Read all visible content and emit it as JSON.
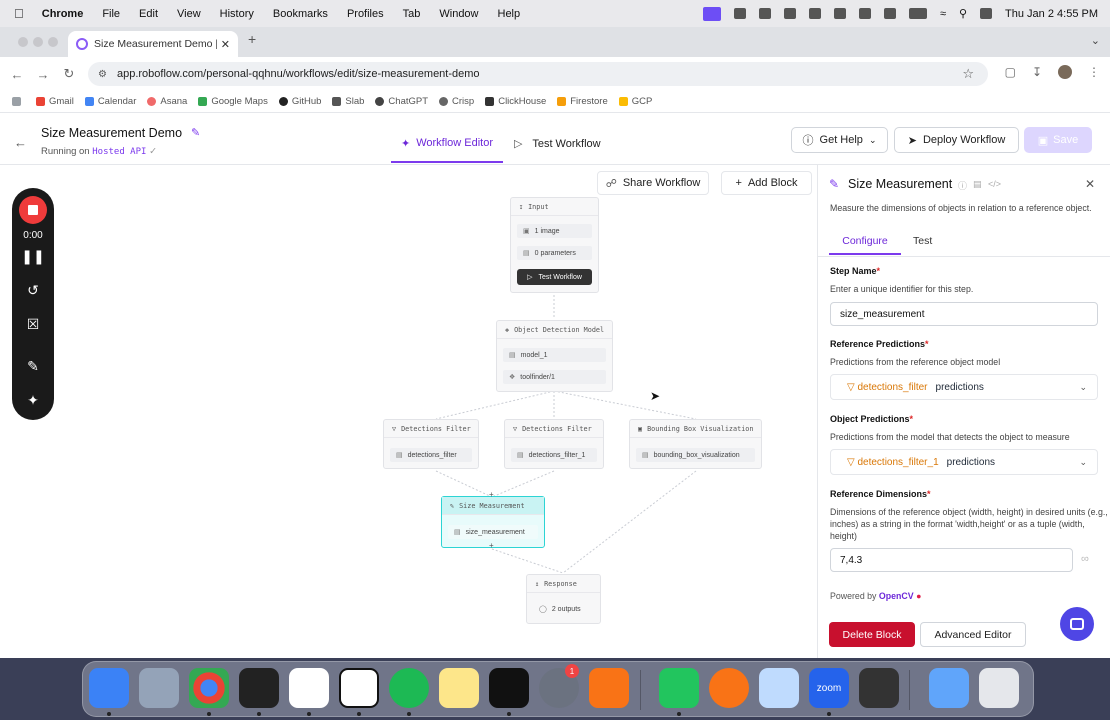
{
  "menubar": {
    "app": "Chrome",
    "items": [
      "File",
      "Edit",
      "View",
      "History",
      "Bookmarks",
      "Profiles",
      "Tab",
      "Window",
      "Help"
    ],
    "datetime": "Thu Jan 2  4:55 PM"
  },
  "browser": {
    "tab_title": "Size Measurement Demo | W",
    "url": "app.roboflow.com/personal-qqhnu/workflows/edit/size-measurement-demo",
    "bookmarks": [
      "Gmail",
      "Calendar",
      "Asana",
      "Google Maps",
      "GitHub",
      "Slab",
      "ChatGPT",
      "Crisp",
      "ClickHouse",
      "Firestore",
      "GCP"
    ]
  },
  "header": {
    "title": "Size Measurement Demo",
    "running_prefix": "Running on",
    "running_target": "Hosted API",
    "tab_editor": "Workflow Editor",
    "tab_test": "Test Workflow",
    "get_help": "Get Help",
    "deploy": "Deploy Workflow",
    "save": "Save"
  },
  "recorder": {
    "time": "0:00"
  },
  "canvas": {
    "share": "Share Workflow",
    "add_block": "Add Block",
    "nodes": {
      "input": {
        "title": "Input",
        "rows": [
          "1 image",
          "0 parameters"
        ],
        "button": "Test Workflow"
      },
      "odm": {
        "title": "Object Detection Model",
        "rows": [
          "model_1",
          "toolfinder/1"
        ]
      },
      "df1": {
        "title": "Detections Filter",
        "rows": [
          "detections_filter"
        ]
      },
      "df2": {
        "title": "Detections Filter",
        "rows": [
          "detections_filter_1"
        ]
      },
      "bbv": {
        "title": "Bounding Box Visualization",
        "rows": [
          "bounding_box_visualization"
        ]
      },
      "sm": {
        "title": "Size Measurement",
        "rows": [
          "size_measurement"
        ]
      },
      "resp": {
        "title": "Response",
        "rows": [
          "2 outputs"
        ]
      }
    }
  },
  "panel": {
    "title": "Size Measurement",
    "description": "Measure the dimensions of objects in relation to a reference object.",
    "tab_configure": "Configure",
    "tab_test": "Test",
    "step_name_label": "Step Name",
    "step_name_desc": "Enter a unique identifier for this step.",
    "step_name_value": "size_measurement",
    "ref_pred_label": "Reference Predictions",
    "ref_pred_desc": "Predictions from the reference object model",
    "ref_pred_source": "detections_filter",
    "ref_pred_field": "predictions",
    "obj_pred_label": "Object Predictions",
    "obj_pred_desc": "Predictions from the model that detects the object to measure",
    "obj_pred_source": "detections_filter_1",
    "obj_pred_field": "predictions",
    "ref_dim_label": "Reference Dimensions",
    "ref_dim_desc": "Dimensions of the reference object (width, height) in desired units (e.g., inches) as a string in the format 'width,height' or as a tuple (width, height)",
    "ref_dim_value": "7,4.3",
    "powered_by": "Powered by",
    "powered_name": "OpenCV",
    "delete": "Delete Block",
    "advanced": "Advanced Editor"
  },
  "dock": {
    "badge": "1",
    "apps": [
      "finder-icon",
      "launchpad-icon",
      "chrome-icon",
      "cursor-icon",
      "slack-icon",
      "notion-icon",
      "spotify-icon",
      "notes-icon",
      "activity-monitor-icon",
      "system-settings-icon",
      "pen-icon",
      "messages-icon",
      "firefox-icon",
      "preview-icon",
      "zoom-icon",
      "calculator-icon",
      "folder-icon",
      "trash-icon"
    ],
    "zoom_label": "zoom"
  },
  "colors": {
    "accent": "#7c3aed",
    "danger": "#c8102e",
    "selected_node": "#2dd4d4"
  }
}
